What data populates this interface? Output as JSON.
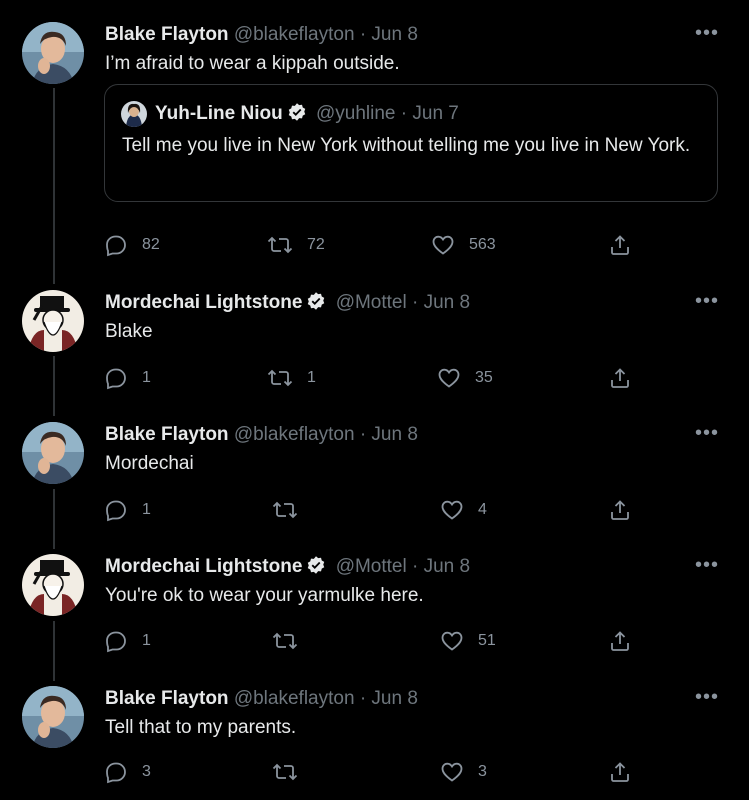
{
  "tweets": [
    {
      "name": "Blake Flayton",
      "handle": "@blakeflayton",
      "sep": "·",
      "date": "Jun 8",
      "verified": false,
      "text": "I’m afraid to wear a kippah outside.",
      "quote": {
        "name": "Yuh-Line Niou",
        "handle": "@yuhline",
        "sep": "·",
        "date": "Jun 7",
        "verified": true,
        "text": "Tell me you live in New York without telling me you live in New York."
      },
      "replies": "82",
      "retweets": "72",
      "likes": "563"
    },
    {
      "name": "Mordechai Lightstone",
      "handle": "@Mottel",
      "sep": "·",
      "date": "Jun 8",
      "verified": true,
      "text": "Blake",
      "replies": "1",
      "retweets": "1",
      "likes": "35"
    },
    {
      "name": "Blake Flayton",
      "handle": "@blakeflayton",
      "sep": "·",
      "date": "Jun 8",
      "verified": false,
      "text": "Mordechai",
      "replies": "1",
      "retweets": "",
      "likes": "4"
    },
    {
      "name": "Mordechai Lightstone",
      "handle": "@Mottel",
      "sep": "·",
      "date": "Jun 8",
      "verified": true,
      "text": "You're ok to wear your yarmulke here.",
      "replies": "1",
      "retweets": "",
      "likes": "51"
    },
    {
      "name": "Blake Flayton",
      "handle": "@blakeflayton",
      "sep": "·",
      "date": "Jun 8",
      "verified": false,
      "text": "Tell that to my parents.",
      "replies": "3",
      "retweets": "",
      "likes": "3"
    }
  ],
  "more_label": "•••",
  "icons": {
    "reply": "reply-icon",
    "retweet": "retweet-icon",
    "like": "heart-icon",
    "share": "share-icon",
    "verified": "verified-badge-icon"
  },
  "colors": {
    "background": "#000000",
    "name": "#e7e9ea",
    "muted": "#6e767d",
    "border": "#333639"
  }
}
